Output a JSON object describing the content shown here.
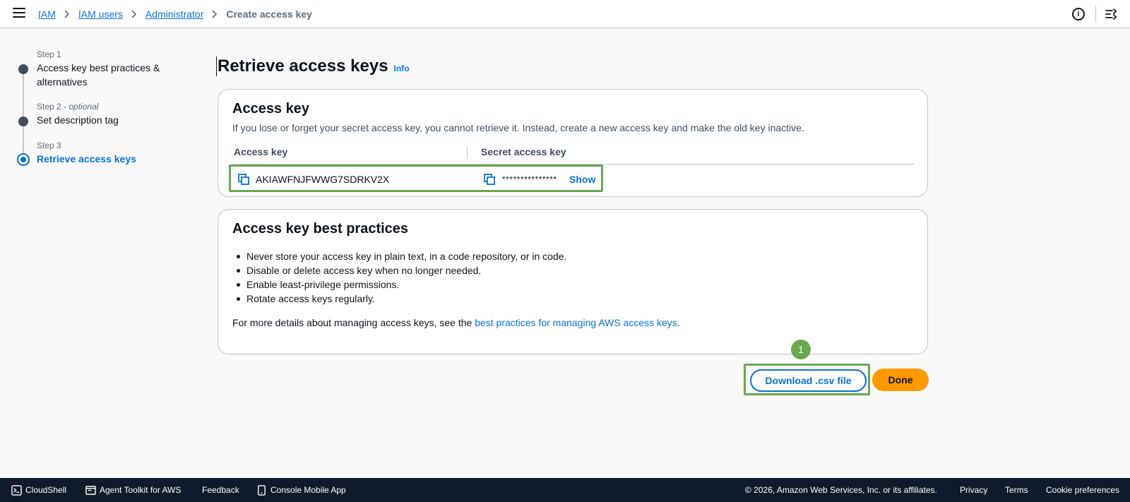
{
  "breadcrumb": {
    "items": [
      "IAM",
      "IAM users",
      "Administrator"
    ],
    "current": "Create access key"
  },
  "steps": [
    {
      "label": "Step 1",
      "optional": "",
      "title": "Access key best practices & alternatives"
    },
    {
      "label": "Step 2",
      "optional": "optional",
      "title": "Set description tag"
    },
    {
      "label": "Step 3",
      "optional": "",
      "title": "Retrieve access keys"
    }
  ],
  "page": {
    "title": "Retrieve access keys",
    "info_link": "Info"
  },
  "access_key_card": {
    "title": "Access key",
    "description": "If you lose or forget your secret access key, you cannot retrieve it. Instead, create a new access key and make the old key inactive.",
    "col_access_key": "Access key",
    "col_secret_key": "Secret access key",
    "access_key_value": "AKIAWFNJFWWG7SDRKV2X",
    "secret_key_masked": "***************",
    "show_label": "Show"
  },
  "best_practices_card": {
    "title": "Access key best practices",
    "bullets": [
      "Never store your access key in plain text, in a code repository, or in code.",
      "Disable or delete access key when no longer needed.",
      "Enable least-privilege permissions.",
      "Rotate access keys regularly."
    ],
    "more_prefix": "For more details about managing access keys, see the ",
    "more_link": "best practices for managing AWS access keys",
    "more_suffix": "."
  },
  "actions": {
    "annotation_number": "1",
    "download_label": "Download .csv file",
    "done_label": "Done"
  },
  "footer": {
    "cloudshell": "CloudShell",
    "agent_toolkit": "Agent Toolkit for AWS",
    "feedback": "Feedback",
    "mobile_app": "Console Mobile App",
    "copyright": "© 2026, Amazon Web Services, Inc. or its affiliates.",
    "privacy": "Privacy",
    "terms": "Terms",
    "cookies": "Cookie preferences"
  },
  "colors": {
    "link": "#0972d3",
    "primary_button": "#ff9900",
    "highlight": "#6aa84f",
    "footer_bg": "#0f1b2a"
  }
}
